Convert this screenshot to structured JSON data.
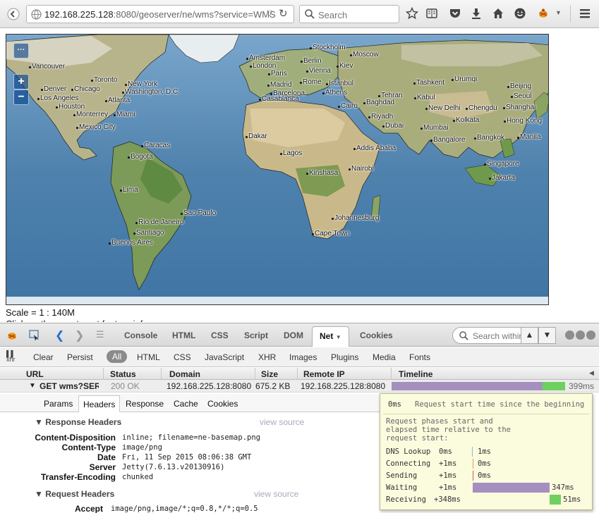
{
  "browser": {
    "url_host": "192.168.225.128",
    "url_path": ":8080/geoserver/ne/wms?service=WMS",
    "search_placeholder": "Search"
  },
  "map": {
    "zoom_in": "+",
    "zoom_out": "−",
    "layer_switcher": "···",
    "scale_text": "Scale = 1 : 140M",
    "click_text": "Click on the map to get feature info",
    "cities": [
      "Vancouver",
      "Toronto",
      "Denver",
      "Chicago",
      "New York",
      "Washington, D.C.",
      "Los Angeles",
      "Atlanta",
      "Houston",
      "Monterrey",
      "Miami",
      "Mexico City",
      "Caracas",
      "Bogota",
      "Lima",
      "Sao Paulo",
      "Rio de Janeiro",
      "Santiago",
      "Buenos Aires",
      "Stockholm",
      "Amsterdam",
      "Berlin",
      "Moscow",
      "London",
      "Paris",
      "Vienna",
      "Kiev",
      "Madrid",
      "Rome",
      "Istanbul",
      "Barcelona",
      "Athens",
      "Casablanca",
      "Tehran",
      "Kabul",
      "Cairo",
      "Baghdad",
      "Riyadh",
      "Dubai",
      "Urumqi",
      "Tashkent",
      "Beijing",
      "Seoul",
      "New Delhi",
      "Chengdu",
      "Shanghai",
      "Kolkata",
      "Hong Kong",
      "Mumbai",
      "Bangkok",
      "Manila",
      "Bangalore",
      "Singapore",
      "Jakarta",
      "Dakar",
      "Lagos",
      "Addis Ababa",
      "Nairobi",
      "Kinshasa",
      "Johannesburg",
      "Cape Town"
    ]
  },
  "firebug": {
    "tabs": [
      "Console",
      "HTML",
      "CSS",
      "Script",
      "DOM",
      "Net",
      "Cookies"
    ],
    "active_tab": "Net",
    "search_placeholder": "Search within Net panel",
    "filters": [
      "Clear",
      "Persist",
      "All",
      "HTML",
      "CSS",
      "JavaScript",
      "XHR",
      "Images",
      "Plugins",
      "Media",
      "Fonts"
    ],
    "xhr_label": "xhr",
    "columns": [
      "URL",
      "Status",
      "Domain",
      "Size",
      "Remote IP",
      "Timeline"
    ],
    "request": {
      "url": "GET wms?SER\\",
      "status": "200 OK",
      "domain": "192.168.225.128:8080",
      "size": "675.2 KB",
      "remote_ip": "192.168.225.128:8080",
      "total_time": "399ms",
      "waiting_ms": 347,
      "receiving_ms": 51
    },
    "detail_tabs": [
      "Params",
      "Headers",
      "Response",
      "Cache",
      "Cookies"
    ],
    "active_detail_tab": "Headers",
    "response_headers_title": "Response Headers",
    "request_headers_title": "Request Headers",
    "view_source": "view source",
    "response_headers": [
      {
        "name": "Content-Disposition",
        "value": "inline; filename=ne-basemap.png"
      },
      {
        "name": "Content-Type",
        "value": "image/png"
      },
      {
        "name": "Date",
        "value": "Fri, 11 Sep 2015 08:06:38 GMT"
      },
      {
        "name": "Server",
        "value": "Jetty(7.6.13.v20130916)"
      },
      {
        "name": "Transfer-Encoding",
        "value": "chunked"
      }
    ],
    "request_headers": [
      {
        "name": "Accept",
        "value": "image/png,image/*;q=0.8,*/*;q=0.5"
      }
    ]
  },
  "tooltip": {
    "start_time": "0ms",
    "start_desc": "Request start time since the beginning",
    "phases_desc_1": "Request phases start and",
    "phases_desc_2": "elapsed time relative to the",
    "phases_desc_3": "request start:",
    "phases": [
      {
        "name": "DNS Lookup",
        "start": "0ms",
        "elapsed": "1ms",
        "color": "#8fb8d8"
      },
      {
        "name": "Connecting",
        "start": "+1ms",
        "elapsed": "0ms",
        "color": "#d8a060"
      },
      {
        "name": "Sending",
        "start": "+1ms",
        "elapsed": "0ms",
        "color": "#c86060"
      },
      {
        "name": "Waiting",
        "start": "+1ms",
        "elapsed": "347ms",
        "color": "#a58fbe"
      },
      {
        "name": "Receiving",
        "start": "+348ms",
        "elapsed": "51ms",
        "color": "#6fd05f"
      }
    ]
  },
  "colors": {
    "waiting_bar": "#a58fbe",
    "receiving_bar": "#6fd05f",
    "ocean": "#5f8fb6",
    "land": "#b9b78e"
  }
}
